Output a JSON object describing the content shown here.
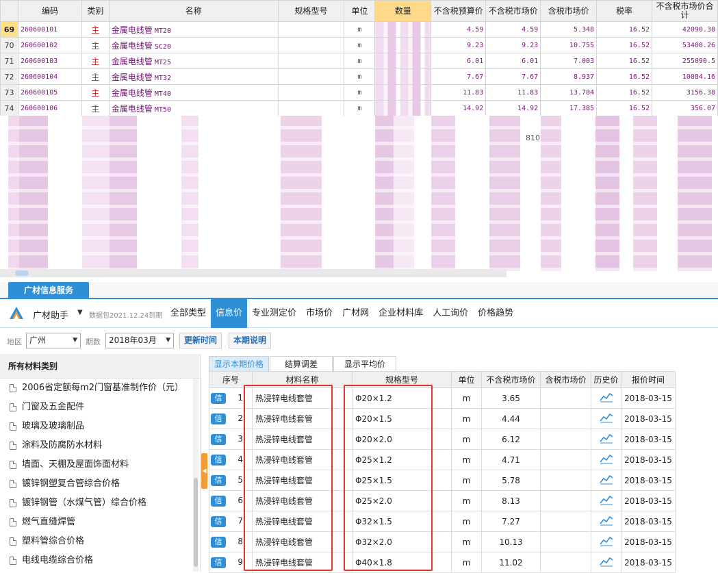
{
  "top_grid": {
    "headers": [
      "编码",
      "类别",
      "名称",
      "规格型号",
      "单位",
      "数量",
      "不含税预算价",
      "不含税市场价",
      "含税市场价",
      "税率",
      "不含税市场价合计"
    ],
    "rows": [
      {
        "rn": "69",
        "code": "260600101",
        "kind": "主",
        "name": "金属电线管",
        "spec": "MT20",
        "unit": "m",
        "budget": "4.59",
        "market": "4.59",
        "tax_market": "5.348",
        "rate": "16.52",
        "total": "42090.38"
      },
      {
        "rn": "70",
        "code": "260600102",
        "kind": "主",
        "name": "金属电线管",
        "spec": "SC20",
        "unit": "m",
        "budget": "9.23",
        "market": "9.23",
        "tax_market": "10.755",
        "rate": "16.52",
        "total": "53400.26"
      },
      {
        "rn": "71",
        "code": "260600103",
        "kind": "主",
        "name": "金属电线管",
        "spec": "MT25",
        "unit": "m",
        "budget": "6.01",
        "market": "6.01",
        "tax_market": "7.003",
        "rate": "16.52",
        "total": "255090.5"
      },
      {
        "rn": "72",
        "code": "260600104",
        "kind": "主",
        "name": "金属电线管",
        "spec": "MT32",
        "unit": "m",
        "budget": "7.67",
        "market": "7.67",
        "tax_market": "8.937",
        "rate": "16.52",
        "total": "10084.16"
      },
      {
        "rn": "73",
        "code": "260600105",
        "kind": "主",
        "name": "金属电线管",
        "spec": "MT40",
        "unit": "m",
        "budget": "11.83",
        "market": "11.83",
        "tax_market": "13.784",
        "rate": "16.52",
        "total": "3156.38"
      },
      {
        "rn": "74",
        "code": "260600106",
        "kind": "主",
        "name": "金属电线管",
        "spec": "MT50",
        "unit": "m",
        "budget": "14.92",
        "market": "14.92",
        "tax_market": "17.385",
        "rate": "16.52",
        "total": "356.07"
      }
    ],
    "blurred_visible_value": "810"
  },
  "panel": {
    "service_tab": "广材信息服务",
    "brand": "广材助手",
    "package_text": "数据包2021.12.24到期",
    "nav_tabs": [
      "全部类型",
      "信息价",
      "专业测定价",
      "市场价",
      "广材网",
      "企业材料库",
      "人工询价",
      "价格趋势"
    ],
    "active_nav": "信息价",
    "filter": {
      "region_label": "地区",
      "region_value": "广州",
      "period_label": "期数",
      "period_value": "2018年03月",
      "btn_update": "更新时间",
      "btn_desc": "本期说明"
    },
    "sidebar": {
      "title": "所有材料类别",
      "items": [
        "2006省定额每m2门窗基准制作价（元）",
        "门窗及五金配件",
        "玻璃及玻璃制品",
        "涂料及防腐防水材料",
        "墙面、天棚及屋面饰面材料",
        "镀锌钢塑复合管综合价格",
        "镀锌钢管（水煤气管）综合价格",
        "燃气直缝焊管",
        "塑料管综合价格",
        "电线电缆综合价格"
      ]
    },
    "sub_tabs": [
      "显示本期价格",
      "结算调差",
      "显示平均价"
    ],
    "table": {
      "headers": [
        "序号",
        "材料名称",
        "规格型号",
        "单位",
        "不含税市场价",
        "含税市场价",
        "历史价",
        "报价时间"
      ],
      "badge": "信",
      "rows": [
        {
          "seq": "1",
          "name": "热浸锌电线套管",
          "spec": "Φ20×1.2",
          "unit": "m",
          "price": "3.65",
          "tax_price": "",
          "date": "2018-03-15"
        },
        {
          "seq": "2",
          "name": "热浸锌电线套管",
          "spec": "Φ20×1.5",
          "unit": "m",
          "price": "4.44",
          "tax_price": "",
          "date": "2018-03-15"
        },
        {
          "seq": "3",
          "name": "热浸锌电线套管",
          "spec": "Φ20×2.0",
          "unit": "m",
          "price": "6.12",
          "tax_price": "",
          "date": "2018-03-15"
        },
        {
          "seq": "4",
          "name": "热浸锌电线套管",
          "spec": "Φ25×1.2",
          "unit": "m",
          "price": "4.71",
          "tax_price": "",
          "date": "2018-03-15"
        },
        {
          "seq": "5",
          "name": "热浸锌电线套管",
          "spec": "Φ25×1.5",
          "unit": "m",
          "price": "5.78",
          "tax_price": "",
          "date": "2018-03-15"
        },
        {
          "seq": "6",
          "name": "热浸锌电线套管",
          "spec": "Φ25×2.0",
          "unit": "m",
          "price": "8.13",
          "tax_price": "",
          "date": "2018-03-15"
        },
        {
          "seq": "7",
          "name": "热浸锌电线套管",
          "spec": "Φ32×1.5",
          "unit": "m",
          "price": "7.27",
          "tax_price": "",
          "date": "2018-03-15"
        },
        {
          "seq": "8",
          "name": "热浸锌电线套管",
          "spec": "Φ32×2.0",
          "unit": "m",
          "price": "10.13",
          "tax_price": "",
          "date": "2018-03-15"
        },
        {
          "seq": "9",
          "name": "热浸锌电线套管",
          "spec": "Φ40×1.8",
          "unit": "m",
          "price": "11.02",
          "tax_price": "",
          "date": "2018-03-15"
        }
      ]
    }
  },
  "icons": {
    "history": "trend-chart-icon",
    "logo": "guangcai-logo-icon",
    "category": "document-icon"
  },
  "colors": {
    "accent": "#2f8fd6",
    "highlight_header": "#ffd98a",
    "annotation_red": "#e3342f",
    "text_purple": "#7a1478"
  }
}
